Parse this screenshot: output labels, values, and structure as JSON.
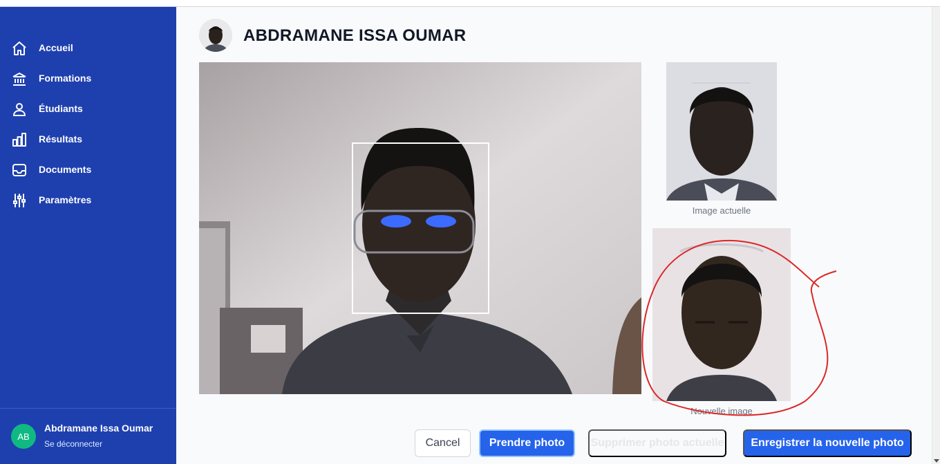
{
  "sidebar": {
    "items": [
      {
        "label": "Accueil",
        "icon": "home-icon"
      },
      {
        "label": "Formations",
        "icon": "building-icon"
      },
      {
        "label": "Étudiants",
        "icon": "user-icon"
      },
      {
        "label": "Résultats",
        "icon": "bar-chart-icon"
      },
      {
        "label": "Documents",
        "icon": "inbox-icon"
      },
      {
        "label": "Paramètres",
        "icon": "sliders-icon"
      }
    ],
    "user": {
      "initials": "AB",
      "name": "Abdramane Issa Oumar",
      "logout_label": "Se déconnecter"
    }
  },
  "page": {
    "title": "ABDRAMANE ISSA OUMAR"
  },
  "photos": {
    "current_caption": "Image actuelle",
    "new_caption": "Nouvelle image"
  },
  "actions": {
    "cancel_label": "Cancel",
    "take_photo_label": "Prendre photo",
    "delete_current_label": "Supprimer photo actuelle",
    "save_new_label": "Enregistrer la nouvelle photo"
  },
  "colors": {
    "sidebar_bg": "#1e40af",
    "primary": "#2563eb",
    "avatar_bg": "#10b981",
    "annotation": "#dc2626"
  }
}
